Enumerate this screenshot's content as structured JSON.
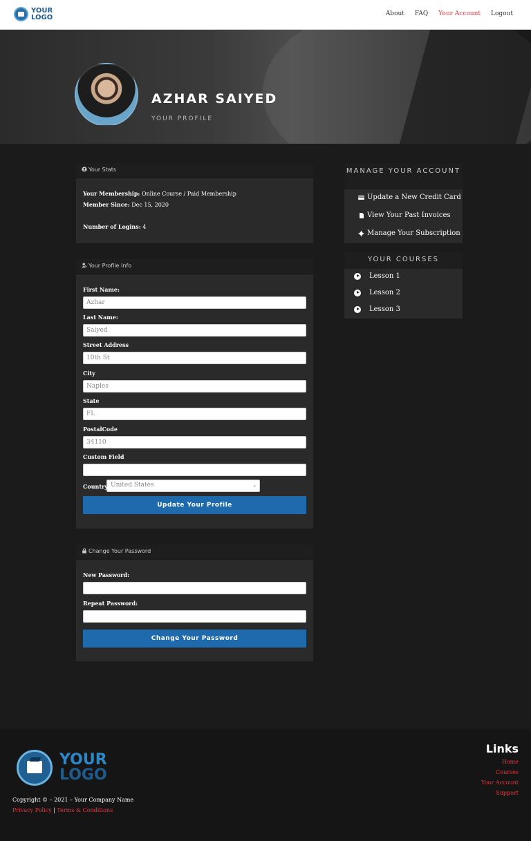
{
  "header": {
    "logo_line1": "YOUR",
    "logo_line2": "LOGO",
    "nav": [
      "About",
      "FAQ",
      "Your Account",
      "Logout"
    ]
  },
  "hero": {
    "name": "AZHAR SAIYED",
    "subtitle": "YOUR PROFILE"
  },
  "stats": {
    "heading": "Your Stats",
    "membership_label": "Your Membership:",
    "membership_value": "Online Course / Paid Membership",
    "since_label": "Member Since:",
    "since_value": "Dec 15, 2020",
    "logins_label": "Number of Logins:",
    "logins_value": "4"
  },
  "profile": {
    "heading": "Your Profile Info",
    "first_name_label": "First Name:",
    "first_name_value": "Azhar",
    "last_name_label": "Last Name:",
    "last_name_value": "Saiyed",
    "street_label": "Street Address",
    "street_value": "10th St",
    "city_label": "City",
    "city_value": "Naples",
    "state_label": "State",
    "state_value": "FL",
    "postal_label": "PostalCode",
    "postal_value": "34110",
    "custom_label": "Custom Field",
    "custom_value": "",
    "country_label": "Country",
    "country_value": "United States",
    "submit_label": "Update Your Profile"
  },
  "password": {
    "heading": "Change Your Password",
    "new_label": "New Password:",
    "repeat_label": "Repeat Password:",
    "submit_label": "Change Your Password"
  },
  "manage": {
    "heading": "MANAGE YOUR ACCOUNT",
    "items": [
      "Update a New Credit Card",
      "View Your Past Invoices",
      "Manage Your Subscription"
    ]
  },
  "courses": {
    "heading": "YOUR COURSES",
    "lessons": [
      "Lesson 1",
      "Lesson 2",
      "Lesson 3"
    ]
  },
  "footer": {
    "logo_line1": "YOUR",
    "logo_line2": "LOGO",
    "copyright": "Copyright © – 2021 – Your Company Name",
    "privacy": "Privacy Policy",
    "separator": "|",
    "terms": "Terms & Conditions",
    "links_title": "Links",
    "links": [
      "Home",
      "Courses",
      "Your Account",
      "Support"
    ]
  },
  "colors": {
    "accent": "#e8373f",
    "button": "#1f69ad"
  }
}
